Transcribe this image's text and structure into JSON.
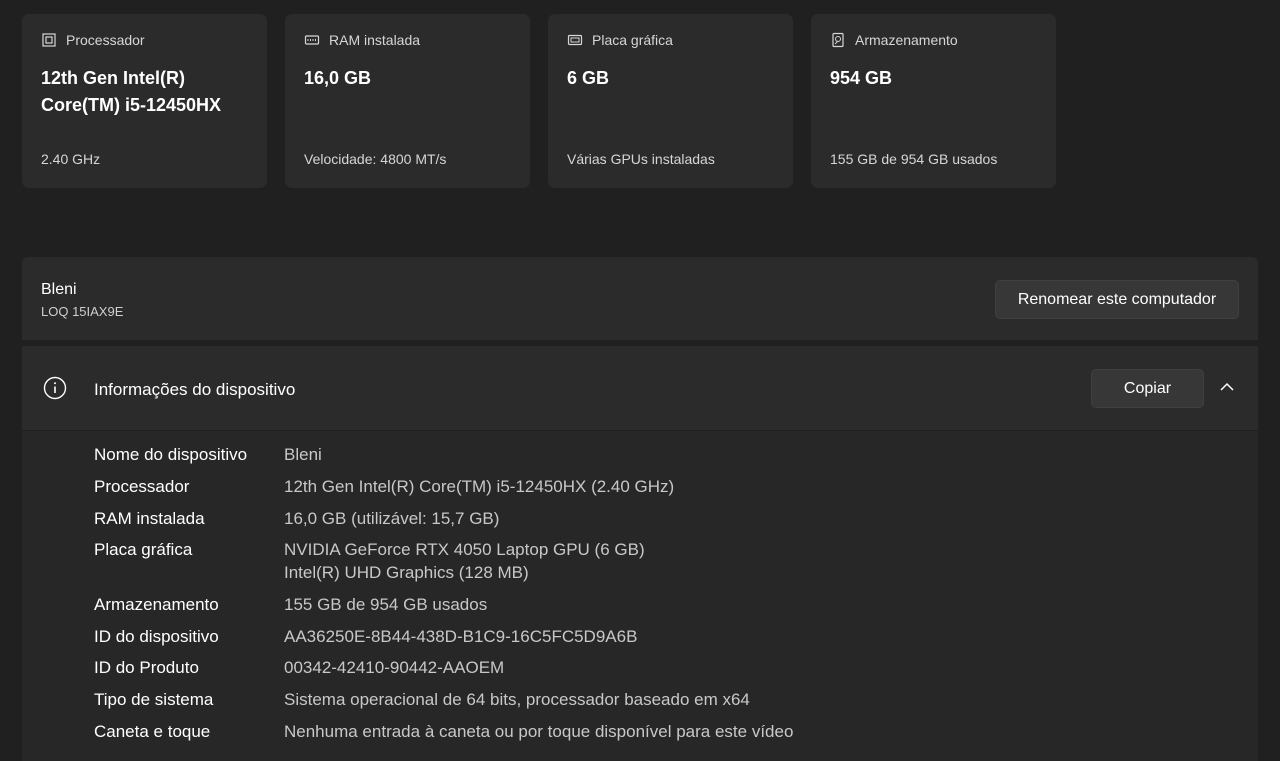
{
  "cards": [
    {
      "icon": "processor-icon",
      "title": "Processador",
      "value": "12th Gen Intel(R) Core(TM) i5-12450HX",
      "sub": "2.40 GHz"
    },
    {
      "icon": "ram-icon",
      "title": "RAM instalada",
      "value": "16,0 GB",
      "sub": "Velocidade: 4800 MT/s"
    },
    {
      "icon": "gpu-icon",
      "title": "Placa gráfica",
      "value": "6 GB",
      "sub": "Várias GPUs instaladas"
    },
    {
      "icon": "storage-icon",
      "title": "Armazenamento",
      "value": "954 GB",
      "sub": "155 GB de 954 GB usados"
    }
  ],
  "device": {
    "name": "Bleni",
    "model": "LOQ 15IAX9E",
    "rename_label": "Renomear este computador"
  },
  "info": {
    "title": "Informações do dispositivo",
    "copy_label": "Copiar",
    "rows": [
      {
        "key": "Nome do dispositivo",
        "value": "Bleni"
      },
      {
        "key": "Processador",
        "value": "12th Gen Intel(R) Core(TM) i5-12450HX (2.40 GHz)"
      },
      {
        "key": "RAM instalada",
        "value": "16,0 GB (utilizável: 15,7 GB)"
      },
      {
        "key": "Placa gráfica",
        "value": "NVIDIA GeForce RTX 4050 Laptop GPU (6 GB)",
        "value2": "Intel(R) UHD Graphics (128 MB)"
      },
      {
        "key": "Armazenamento",
        "value": "155 GB de 954 GB usados"
      },
      {
        "key": "ID do dispositivo",
        "value": "AA36250E-8B44-438D-B1C9-16C5FC5D9A6B"
      },
      {
        "key": "ID do Produto",
        "value": "00342-42410-90442-AAOEM"
      },
      {
        "key": "Tipo de sistema",
        "value": "Sistema operacional de 64 bits, processador baseado em x64"
      },
      {
        "key": "Caneta e toque",
        "value": "Nenhuma entrada à caneta ou por toque disponível para este vídeo"
      }
    ]
  }
}
